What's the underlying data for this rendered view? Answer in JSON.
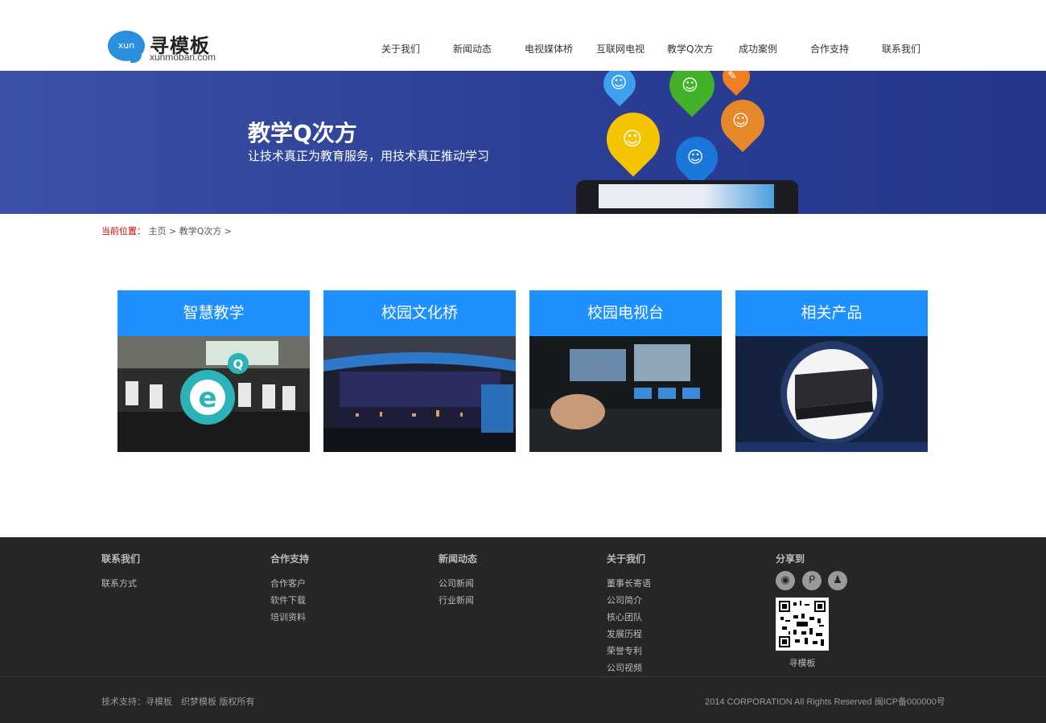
{
  "logo": {
    "badge": "xun",
    "name": "寻模板",
    "domain": "xunmoban.com"
  },
  "nav": [
    {
      "label": "关于我们"
    },
    {
      "label": "新闻动态"
    },
    {
      "label": "电视媒体桥"
    },
    {
      "label": "互联网电视"
    },
    {
      "label": "教学Q次方"
    },
    {
      "label": "成功案例"
    },
    {
      "label": "合作支持"
    },
    {
      "label": "联系我们"
    }
  ],
  "banner": {
    "title": "教学Q次方",
    "subtitle": "让技术真正为教育服务，用技术真正推动学习"
  },
  "breadcrumb": {
    "label": "当前位置：",
    "home": "主页",
    "sep": ">",
    "current": "教学Q次方"
  },
  "cards": [
    {
      "title": "智慧教学"
    },
    {
      "title": "校园文化桥"
    },
    {
      "title": "校园电视台"
    },
    {
      "title": "相关产品"
    }
  ],
  "footer": {
    "columns": [
      {
        "title": "联系我们",
        "links": [
          "联系方式"
        ]
      },
      {
        "title": "合作支持",
        "links": [
          "合作客户",
          "软件下载",
          "培训资料"
        ]
      },
      {
        "title": "新闻动态",
        "links": [
          "公司新闻",
          "行业新闻"
        ]
      },
      {
        "title": "关于我们",
        "links": [
          "董事长寄语",
          "公司简介",
          "核心团队",
          "发展历程",
          "荣誉专利",
          "公司视频"
        ]
      }
    ],
    "share": {
      "title": "分享到",
      "icons": [
        "weibo-icon",
        "tencent-weibo-icon",
        "qq-icon"
      ],
      "qr_caption": "寻模板"
    },
    "copyright_left": "技术支持：寻模板　织梦模板 版权所有",
    "copyright_right": "2014 CORPORATION All Rights Reserved 闽ICP备000000号"
  },
  "colors": {
    "card_head": "#1e90ff",
    "banner": "#2c3f95",
    "footer": "#262626",
    "breadcrumb_label": "#d50000"
  }
}
